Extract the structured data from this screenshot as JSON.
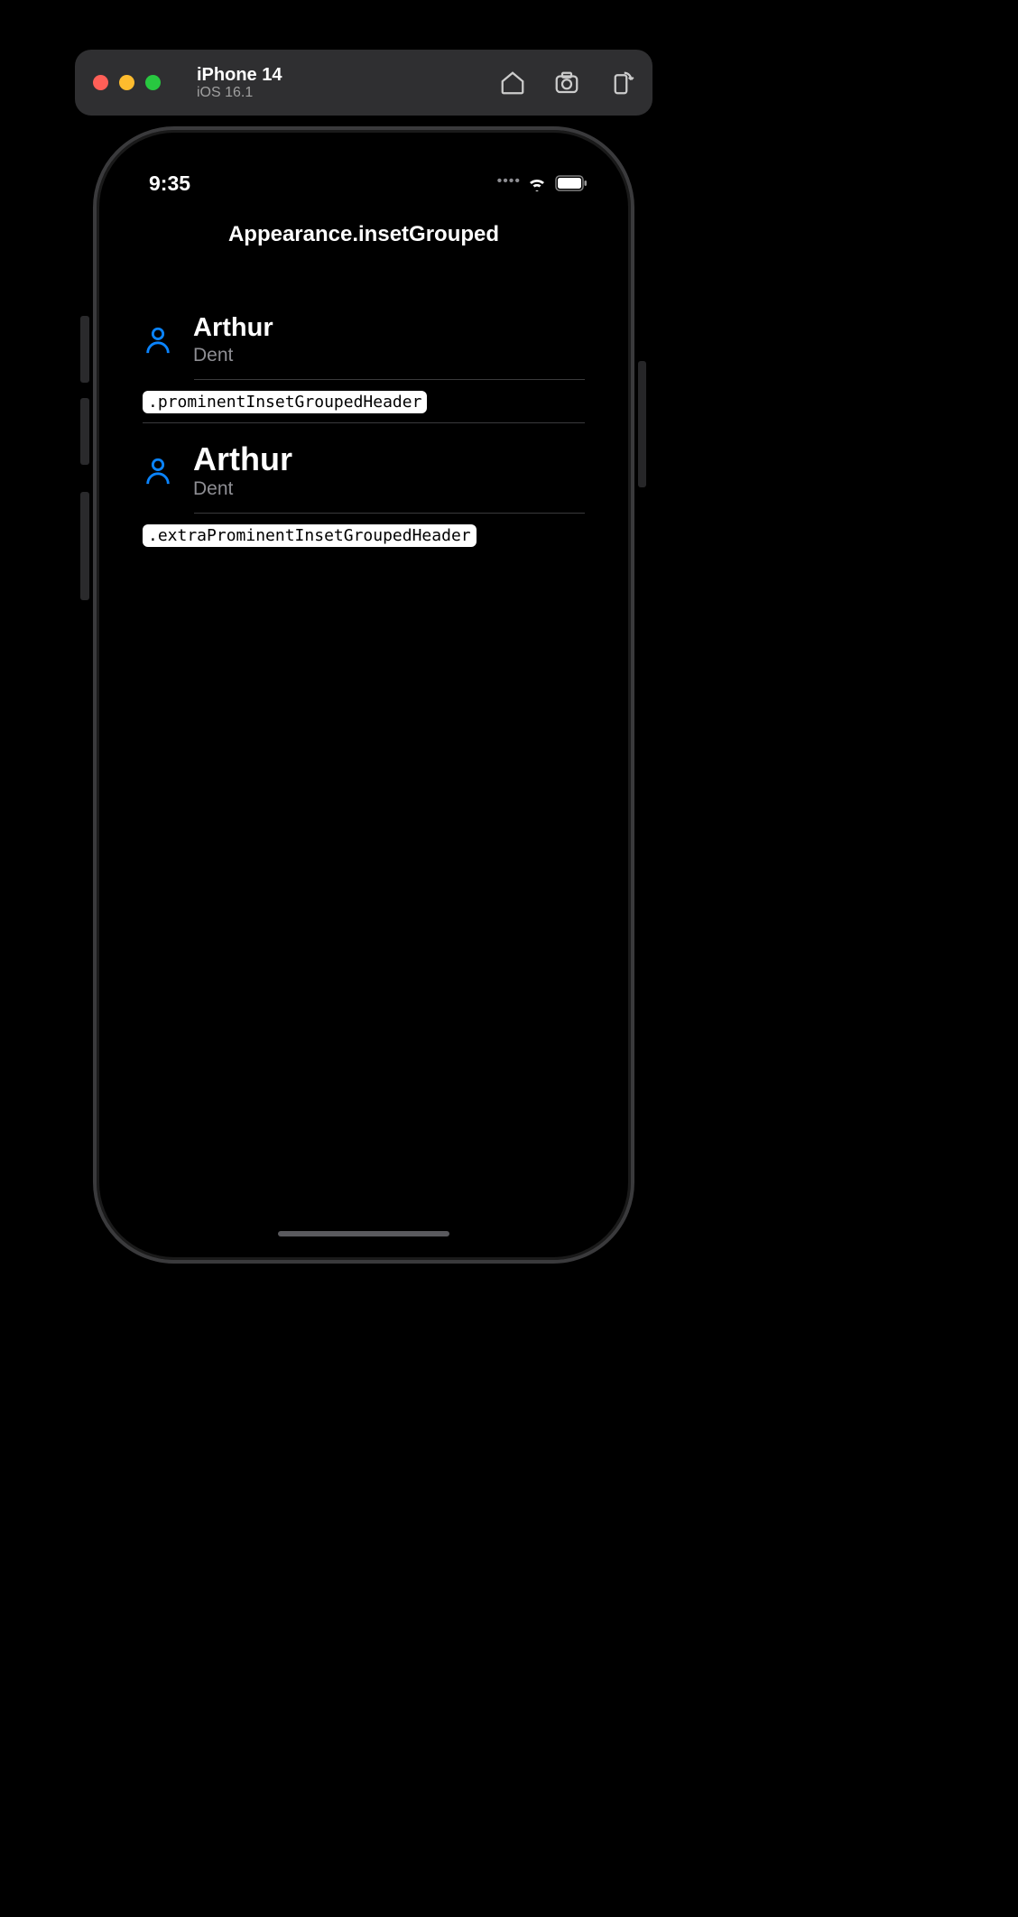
{
  "simulator": {
    "device_name": "iPhone 14",
    "os_version": "iOS 16.1"
  },
  "status": {
    "time": "9:35"
  },
  "nav": {
    "title": "Appearance.insetGrouped"
  },
  "sections": [
    {
      "title": "Arthur",
      "subtitle": "Dent",
      "footer_tag": ".prominentInsetGroupedHeader",
      "title_class": "prominent"
    },
    {
      "title": "Arthur",
      "subtitle": "Dent",
      "footer_tag": ".extraProminentInsetGroupedHeader",
      "title_class": "extra"
    }
  ],
  "colors": {
    "accent": "#0a84ff"
  }
}
